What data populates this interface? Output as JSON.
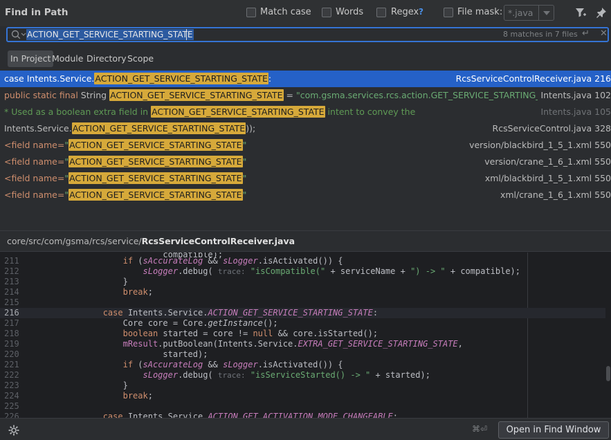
{
  "header": {
    "title": "Find in Path",
    "match_case": "Match case",
    "words": "Words",
    "regex": "Regex",
    "regex_help": "?",
    "file_mask": "File mask:",
    "file_mask_value": "*.java",
    "filter_icon": "filter-icon",
    "pin_icon": "pin-icon"
  },
  "search": {
    "value": "ACTION_GET_SERVICE_STARTING_STATE",
    "match_count": "8 matches in 7 files"
  },
  "scope_tabs": [
    "In Project",
    "Module",
    "Directory",
    "Scope"
  ],
  "results": [
    {
      "pre": "case Intents.Service.",
      "match": "ACTION_GET_SERVICE_STARTING_STATE",
      "post": ":",
      "file": "RcsServiceControlReceiver.java 216"
    },
    {
      "pre_kw": "public static final ",
      "pre": "String ",
      "match": "ACTION_GET_SERVICE_STARTING_STATE",
      "post": " = ",
      "post_str": "\"com.gsma.services.rcs.action.GET_SERVICE_STARTING_S",
      "file": "Intents.java 102"
    },
    {
      "pre_cmt": "* Used as a boolean extra field in ",
      "match": "ACTION_GET_SERVICE_STARTING_STATE",
      "post_cmt": " intent to convey the",
      "file": "Intents.java 105"
    },
    {
      "pre": "Intents.Service.",
      "match": "ACTION_GET_SERVICE_STARTING_STATE",
      "post": "));",
      "file": "RcsServiceControl.java 328"
    },
    {
      "pre": "<field name=",
      "pre_str": "\"",
      "match": "ACTION_GET_SERVICE_STARTING_STATE",
      "post_str": "\"",
      "file": "version/blackbird_1_5_1.xml 550"
    },
    {
      "pre": "<field name=",
      "pre_str": "\"",
      "match": "ACTION_GET_SERVICE_STARTING_STATE",
      "post_str": "\"",
      "file": "version/crane_1_6_1.xml 550"
    },
    {
      "pre": "<field name=",
      "pre_str": "\"",
      "match": "ACTION_GET_SERVICE_STARTING_STATE",
      "post_str": "\"",
      "file": "xml/blackbird_1_5_1.xml 550"
    },
    {
      "pre": "<field name=",
      "pre_str": "\"",
      "match": "ACTION_GET_SERVICE_STARTING_STATE",
      "post_str": "\"",
      "file": "xml/crane_1_6_1.xml 550"
    }
  ],
  "preview": {
    "path_dir": "core/src/com/gsma/rcs/service/",
    "path_file": "RcsServiceControlReceiver.java",
    "line_numbers": [
      "211",
      "212",
      "213",
      "214",
      "215",
      "216",
      "217",
      "218",
      "219",
      "220",
      "221",
      "222",
      "223",
      "224",
      "225",
      "226"
    ]
  },
  "footer": {
    "shortcut": "⌘⏎",
    "open_button": "Open in Find Window"
  },
  "colors": {
    "selection": "#2561c7",
    "match_highlight": "#d6a93a",
    "search_border": "#3574d4"
  }
}
